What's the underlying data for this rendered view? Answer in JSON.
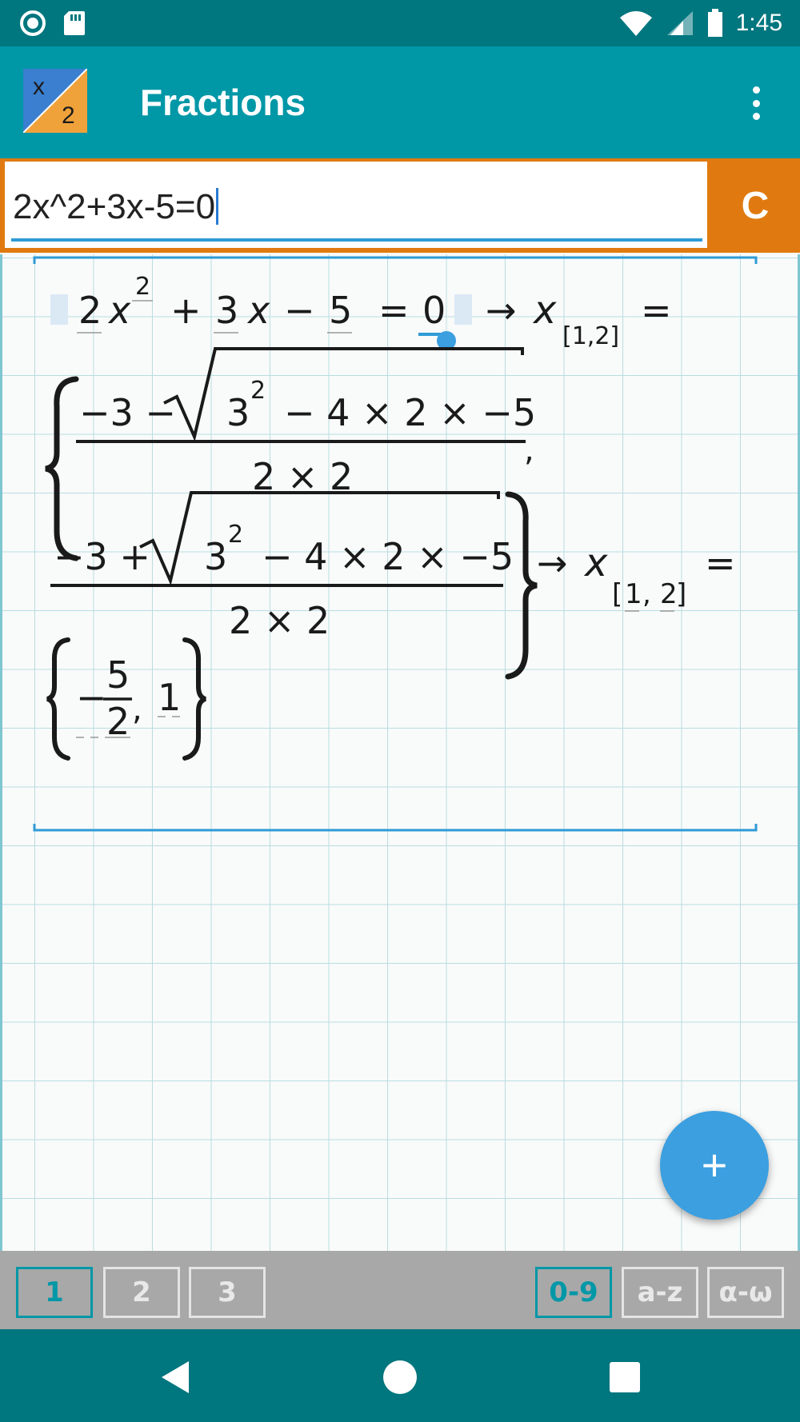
{
  "status_bar": {
    "time": "1:45",
    "icons": [
      "record-icon",
      "sd-card-icon",
      "wifi-icon",
      "signal-icon",
      "battery-icon"
    ]
  },
  "app_bar": {
    "title": "Fractions",
    "logo_top": "x",
    "logo_bottom": "2",
    "menu_icon": "more-vert-icon"
  },
  "input": {
    "value": "2x^2+3x-5=0",
    "clear_label": "C"
  },
  "math": {
    "equation": [
      "2",
      "x",
      "2",
      "+",
      "3",
      "x",
      "−",
      "5",
      "=",
      "0"
    ],
    "arrow": "→",
    "result_var": "x",
    "result_index": "[1,2]",
    "result_index_b": [
      "[",
      "1",
      ",",
      "2",
      "]"
    ],
    "equals": "=",
    "root1": {
      "numerator_pre": "−3 −",
      "radicand": [
        "3",
        "2",
        "− 4 × 2 × −5"
      ],
      "denominator": "2 × 2",
      "comma": ","
    },
    "root2": {
      "numerator_pre": "−3 +",
      "radicand": [
        "3",
        "2",
        "− 4 × 2 × −5"
      ],
      "denominator": "2 × 2"
    },
    "solution": {
      "minus": "−",
      "frac_num": "5",
      "frac_den": "2",
      "comma": ",",
      "second": "1"
    }
  },
  "fab": {
    "label": "+"
  },
  "tabs": {
    "left": [
      "1",
      "2",
      "3"
    ],
    "right": [
      "0-9",
      "a-z",
      "α-ω"
    ],
    "active_left": "1",
    "active_right": "0-9"
  },
  "nav": {
    "back": "back-icon",
    "home": "home-icon",
    "recents": "recents-icon"
  },
  "colors": {
    "status_bar": "#00767f",
    "app_bar": "#0097a7",
    "clear_button": "#e07a10",
    "fab": "#3b9fe0",
    "accent": "#2e9bd6"
  }
}
